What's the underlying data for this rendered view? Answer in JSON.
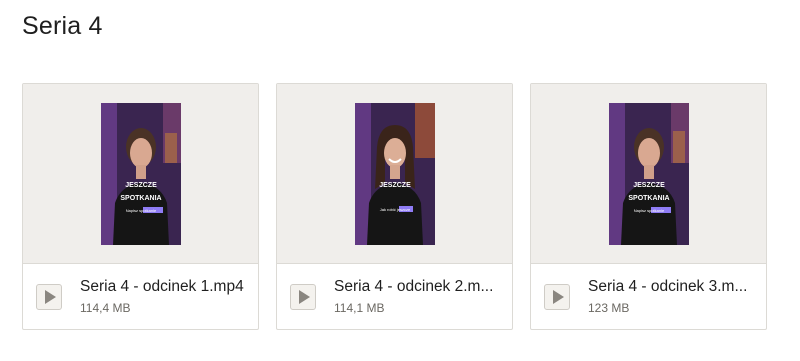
{
  "folder": {
    "title": "Seria 4"
  },
  "files": [
    {
      "name": "Seria 4 - odcinek 1.mp4",
      "size": "114,4 MB",
      "thumb": {
        "line1": "JESZCZE",
        "line2": "SPOTKANIA",
        "caption": "Napisz spotkanie"
      }
    },
    {
      "name": "Seria 4 - odcinek 2.m...",
      "size": "114,1 MB",
      "thumb": {
        "line1": "JESZCZE",
        "line2": "",
        "caption": "Jak robić jeszcze"
      }
    },
    {
      "name": "Seria 4 - odcinek 3.m...",
      "size": "123 MB",
      "thumb": {
        "line1": "JESZCZE",
        "line2": "SPOTKANIA",
        "caption": "Napisz spotkanie"
      }
    }
  ],
  "colors": {
    "card_border": "#dcdad5",
    "preview_bg": "#f0eeeb",
    "thumb_bg_purple": "#6b3f8f",
    "highlight": "#8f7cf5"
  },
  "icons": {
    "play": "play-icon"
  }
}
